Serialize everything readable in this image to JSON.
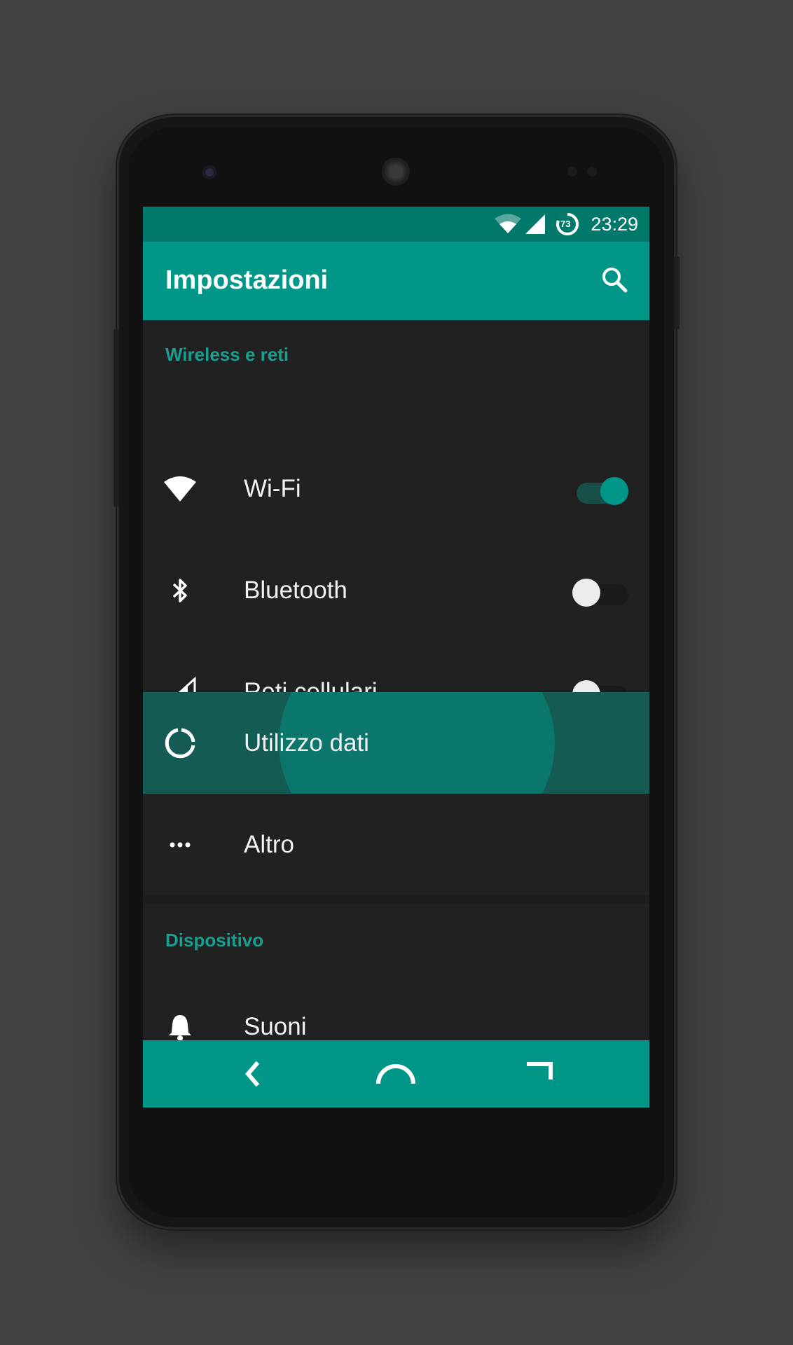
{
  "status_bar": {
    "time": "23:29",
    "battery_level": "73",
    "icons": [
      "wifi-icon",
      "cellular-signal-icon",
      "battery-icon"
    ]
  },
  "app_bar": {
    "title": "Impostazioni",
    "search_icon": "search-icon"
  },
  "sections": [
    {
      "header": "Wireless e reti",
      "items": [
        {
          "label": "Wi-Fi",
          "icon": "wifi-icon",
          "toggle": true
        },
        {
          "label": "Bluetooth",
          "icon": "bluetooth-icon",
          "toggle": false
        },
        {
          "label": "Reti cellulari",
          "icon": "cellular-signal-icon",
          "toggle": false
        },
        {
          "label": "Utilizzo dati",
          "icon": "data-usage-icon",
          "pressed": true
        },
        {
          "label": "Altro",
          "icon": "more-dots-icon"
        }
      ]
    },
    {
      "header": "Dispositivo",
      "items": [
        {
          "label": "Suoni",
          "icon": "bell-icon"
        }
      ]
    }
  ],
  "nav_bar": [
    "back-icon",
    "home-icon",
    "recents-icon"
  ],
  "colors": {
    "accent": "#009688",
    "status_bar": "#00796b",
    "background": "#212121",
    "section_header": "#1a9e8f",
    "pressed_row": "#145b54",
    "ripple": "#0b766c"
  }
}
